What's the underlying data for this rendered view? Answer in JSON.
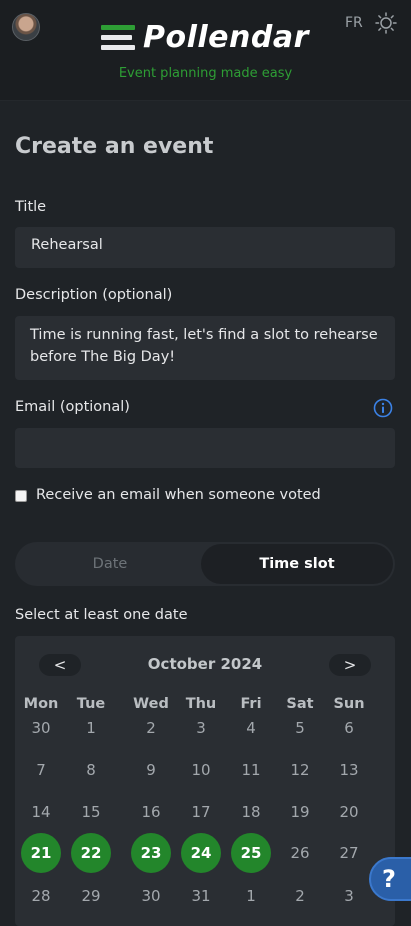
{
  "header": {
    "logo_text": "Pollendar",
    "tagline": "Event planning made easy",
    "language": "FR"
  },
  "form": {
    "heading": "Create an event",
    "title_label": "Title",
    "title_value": "Rehearsal",
    "description_label": "Description (optional)",
    "description_value": "Time is running fast, let's find a slot to rehearse before The Big Day!",
    "email_label": "Email (optional)",
    "email_value": "",
    "notify_label": "Receive an email when someone voted",
    "notify_checked": false
  },
  "mode_toggle": {
    "options": [
      "Date",
      "Time slot"
    ],
    "selected": "Time slot"
  },
  "calendar": {
    "select_label": "Select at least one date",
    "prev_label": "<",
    "next_label": ">",
    "month_label": "October 2024",
    "weekdays": [
      "Mon",
      "Tue",
      "Wed",
      "Thu",
      "Fri",
      "Sat",
      "Sun"
    ],
    "weeks": [
      [
        "30",
        "1",
        "2",
        "3",
        "4",
        "5",
        "6"
      ],
      [
        "7",
        "8",
        "9",
        "10",
        "11",
        "12",
        "13"
      ],
      [
        "14",
        "15",
        "16",
        "17",
        "18",
        "19",
        "20"
      ],
      [
        "21",
        "22",
        "23",
        "24",
        "25",
        "26",
        "27"
      ],
      [
        "28",
        "29",
        "30",
        "31",
        "1",
        "2",
        "3"
      ]
    ],
    "selected_days": [
      "21",
      "22",
      "23",
      "24",
      "25"
    ]
  },
  "help_button": {
    "label": "?"
  },
  "colors": {
    "accent": "#2e9e35",
    "selected_day": "#23862b",
    "help": "#2a5fa8",
    "background": "#1f2327"
  }
}
